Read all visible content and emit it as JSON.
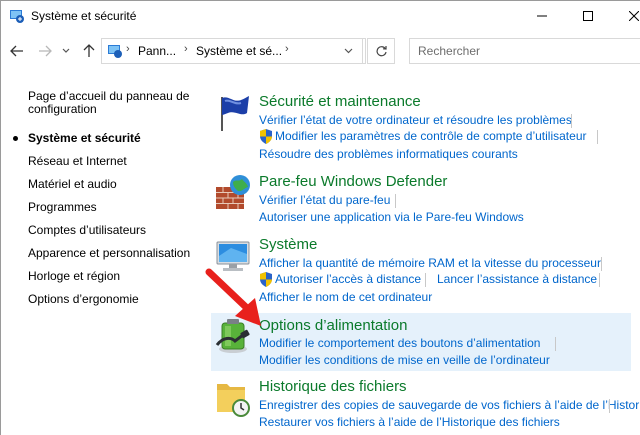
{
  "window": {
    "title": "Système et sécurité"
  },
  "address_bar": {
    "crumbs": [
      "Pann...",
      "Système et sé..."
    ],
    "search_placeholder": "Rechercher"
  },
  "sidebar": {
    "items": [
      {
        "label": "Page d’accueil du panneau de",
        "label2": "configuration"
      },
      {
        "label": "Système et sécurité",
        "active": true
      },
      {
        "label": "Réseau et Internet"
      },
      {
        "label": "Matériel et audio"
      },
      {
        "label": "Programmes"
      },
      {
        "label": "Comptes d’utilisateurs"
      },
      {
        "label": "Apparence et personnalisation"
      },
      {
        "label": "Horloge et région"
      },
      {
        "label": "Options d’ergonomie"
      }
    ]
  },
  "categories": [
    {
      "title": "Sécurité et maintenance",
      "icon": "flag-icon",
      "links": [
        "Vérifier l’état de votre ordinateur et résoudre les problèmes",
        "Modifier les paramètres de contrôle de compte d’utilisateur",
        "Résoudre des problèmes informatiques courants"
      ]
    },
    {
      "title": "Pare-feu Windows Defender",
      "icon": "firewall-icon",
      "links": [
        "Vérifier l’état du pare-feu",
        "Autoriser une application via le Pare-feu Windows"
      ]
    },
    {
      "title": "Système",
      "icon": "computer-icon",
      "links": [
        "Afficher la quantité de mémoire RAM et la vitesse du processeur",
        "Autoriser l’accès à distance",
        "Lancer l’assistance à distance",
        "Afficher le nom de cet ordinateur"
      ]
    },
    {
      "title": "Options d’alimentation",
      "icon": "battery-icon",
      "links": [
        "Modifier le comportement des boutons d’alimentation",
        "Modifier les conditions de mise en veille de l’ordinateur"
      ]
    },
    {
      "title": "Historique des fichiers",
      "icon": "file-history-icon",
      "links": [
        "Enregistrer des copies de sauvegarde de vos fichiers à l’aide de l’Histori",
        "Restaurer vos fichiers à l’aide de l’Historique des fichiers"
      ]
    }
  ],
  "colors": {
    "category_title": "#0b7a2b",
    "link": "#0066cc",
    "highlight": "#e5f1fb",
    "annotation_arrow": "#e8201c"
  }
}
